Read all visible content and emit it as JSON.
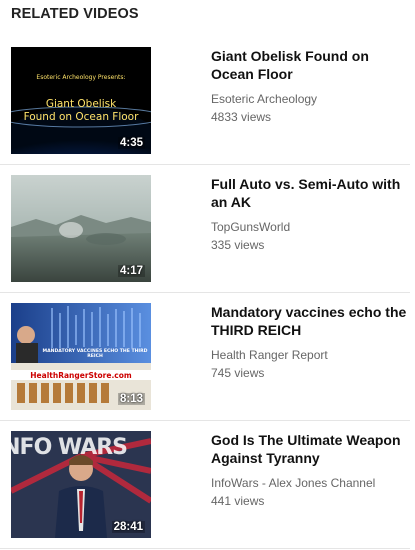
{
  "section_title": "RELATED VIDEOS",
  "videos": [
    {
      "title": "Giant Obelisk Found on Ocean Floor",
      "channel": "Esoteric Archeology",
      "views": "4833 views",
      "duration": "4:35",
      "thumb_small": "Esoteric Archeology Presents:",
      "thumb_line1": "Giant Obelisk",
      "thumb_line2": "Found on Ocean Floor"
    },
    {
      "title": "Full Auto vs. Semi-Auto with an AK",
      "channel": "TopGunsWorld",
      "views": "335 views",
      "duration": "4:17"
    },
    {
      "title": "Mandatory vaccines echo the THIRD REICH",
      "channel": "Health Ranger Report",
      "views": "745 views",
      "duration": "8:13",
      "thumb_banner": "MANDATORY VACCINES ECHO THE THIRD REICH",
      "thumb_site": "HealthRangerStore.com"
    },
    {
      "title": "God Is The Ultimate Weapon Against Tyranny",
      "channel": "InfoWars - Alex Jones Channel",
      "views": "441 views",
      "duration": "28:41",
      "thumb_logo": "INFO WARS"
    }
  ]
}
